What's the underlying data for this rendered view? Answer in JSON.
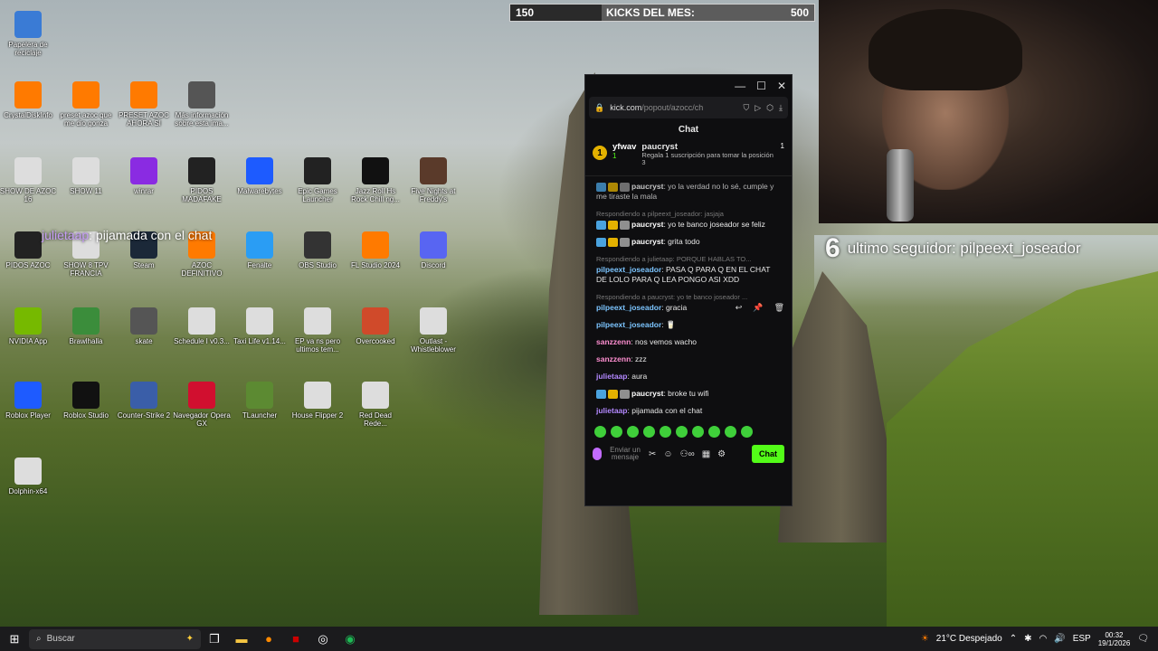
{
  "kicks": {
    "current": "150",
    "label": "KICKS DEL MES:",
    "goal": "500",
    "progress": 0.3
  },
  "overlay": {
    "chat_user": "julietaap",
    "chat_text": ": pijamada con el chat",
    "follower_num": "6",
    "follower_text": "ultimo seguidor: pilpeext_joseador"
  },
  "desktop_icons": [
    {
      "label": "Papelera de reciclaje",
      "icon": "recycle-bin-icon"
    },
    {
      "label": "CrystalDiskInfo",
      "icon": "crystaldisk-icon"
    },
    {
      "label": "preset azoc que me dio gonza",
      "icon": "fl-studio-icon"
    },
    {
      "label": "PRESET AZOC AHORA SI",
      "icon": "fl-studio-icon"
    },
    {
      "label": "Más información sobre esta ima...",
      "icon": "camera-info-icon"
    },
    {
      "label": "SHOW DE AZOC 16",
      "icon": "audio-file-icon"
    },
    {
      "label": "SHOW 11",
      "icon": "audio-file-icon"
    },
    {
      "label": "winrar",
      "icon": "winrar-icon"
    },
    {
      "label": "PIDOS MADAFAKE",
      "icon": "folder-icon"
    },
    {
      "label": "Malwarebytes",
      "icon": "malwarebytes-icon"
    },
    {
      "label": "Epic Games Launcher",
      "icon": "epic-games-icon"
    },
    {
      "label": "Jazz Roll Hs Rock Chill ng...",
      "icon": "ball-icon"
    },
    {
      "label": "Five Nights at Freddy's",
      "icon": "fnaf-icon"
    },
    {
      "label": "PIDOS AZOC",
      "icon": "folder-icon"
    },
    {
      "label": "SHOW 8 TPV FRANCIA",
      "icon": "audio-file-icon"
    },
    {
      "label": "Steam",
      "icon": "steam-icon"
    },
    {
      "label": "AZOC DEFINITIVO",
      "icon": "fl-studio-icon"
    },
    {
      "label": "Fenalte",
      "icon": "fenalte-icon"
    },
    {
      "label": "OBS Studio",
      "icon": "obs-icon"
    },
    {
      "label": "FL Studio 2024",
      "icon": "fl-studio-icon"
    },
    {
      "label": "Discord",
      "icon": "discord-icon"
    },
    {
      "label": "NVIDIA App",
      "icon": "nvidia-icon"
    },
    {
      "label": "Brawlhalla",
      "icon": "brawlhalla-icon"
    },
    {
      "label": "skate",
      "icon": "skate-icon"
    },
    {
      "label": "Schedule I v0.3...",
      "icon": "file-icon"
    },
    {
      "label": "Taxi Life v1.14...",
      "icon": "file-icon"
    },
    {
      "label": "EP va ns pero ultimos tem...",
      "icon": "audio-file-icon"
    },
    {
      "label": "Overcooked",
      "icon": "overcooked-icon"
    },
    {
      "label": "Outlast - Whistleblower",
      "icon": "file-icon"
    },
    {
      "label": "Roblox Player",
      "icon": "roblox-icon"
    },
    {
      "label": "Roblox Studio",
      "icon": "roblox-studio-icon"
    },
    {
      "label": "Counter-Strike 2",
      "icon": "cs2-icon"
    },
    {
      "label": "Navegador Opera GX",
      "icon": "opera-icon"
    },
    {
      "label": "TLauncher",
      "icon": "tlauncher-icon"
    },
    {
      "label": "House Flipper 2",
      "icon": "file-icon"
    },
    {
      "label": "Red Dead Rede...",
      "icon": "file-icon"
    },
    {
      "label": "Dolphin-x64",
      "icon": "file-icon"
    }
  ],
  "popup": {
    "url_host": "kick.com",
    "url_path": "/popout/azocc/ch",
    "title": "Chat",
    "pinned": {
      "rank": "1",
      "user1": "yfwav",
      "user1_count": "1",
      "user2": "paucryst",
      "user2_count": "1",
      "user2_note": "Regala 1 suscripción para tomar la posición 3"
    },
    "messages": [
      {
        "reply": "",
        "user": "paucryst",
        "cls": "u-pau",
        "badges": true,
        "text": "yo la verdad no lo sé, cumple y me tiraste la mala",
        "faded": true
      },
      {
        "reply": "Respondiendo a pilpeext_joseador: jasjaja",
        "user": "paucryst",
        "cls": "u-pau",
        "badges": true,
        "text": "yo te banco joseador se feliz"
      },
      {
        "reply": "",
        "user": "paucryst",
        "cls": "u-pau",
        "badges": true,
        "text": "grita todo"
      },
      {
        "reply": "Respondiendo a julietaap: PORQUE HABLAS TO...",
        "user": "pilpeext_joseador",
        "cls": "u-pil",
        "badges": false,
        "text": "PASA Q PARA Q EN EL CHAT DE LOLO PARA Q LEA PONGO ASI XDD"
      },
      {
        "reply": "Respondiendo a paucryst: yo te banco joseador ...",
        "user": "pilpeext_joseador",
        "cls": "u-pil",
        "badges": false,
        "text": "gracia"
      },
      {
        "reply": "",
        "user": "pilpeext_joseador",
        "cls": "u-pil",
        "badges": false,
        "text": "🥛"
      },
      {
        "reply": "",
        "user": "sanzzenn",
        "cls": "u-san",
        "badges": false,
        "text": "nos vemos wacho"
      },
      {
        "reply": "",
        "user": "sanzzenn",
        "cls": "u-san",
        "badges": false,
        "text": "zzz"
      },
      {
        "reply": "",
        "user": "julietaap",
        "cls": "u-jul",
        "badges": false,
        "text": "aura"
      },
      {
        "reply": "",
        "user": "paucryst",
        "cls": "u-pau",
        "badges": true,
        "text": "broke tu wifi"
      },
      {
        "reply": "",
        "user": "julietaap",
        "cls": "u-jul",
        "badges": false,
        "text": "pijamada con el chat"
      }
    ],
    "input_placeholder": "Enviar un mensaje",
    "send_label": "Chat"
  },
  "taskbar": {
    "search_placeholder": "Buscar",
    "weather": "21°C Despejado",
    "lang": "ESP",
    "time": "00:32",
    "date": "19/1/2026"
  }
}
